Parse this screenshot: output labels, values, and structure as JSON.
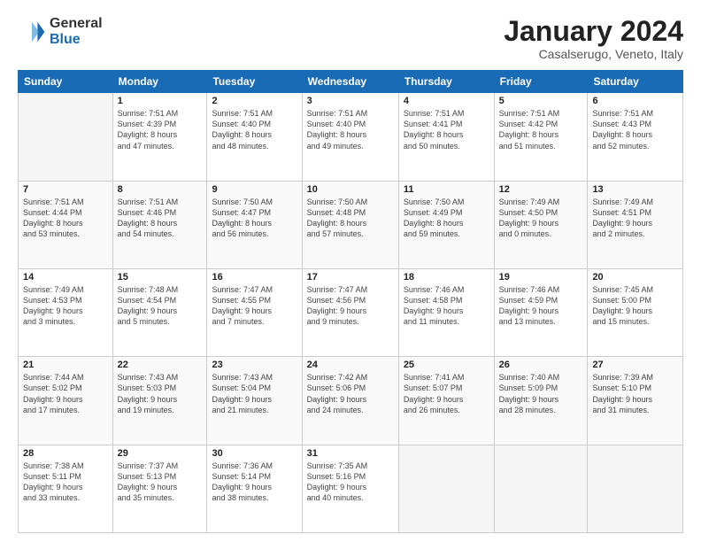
{
  "logo": {
    "general": "General",
    "blue": "Blue"
  },
  "title": "January 2024",
  "subtitle": "Casalserugo, Veneto, Italy",
  "days_header": [
    "Sunday",
    "Monday",
    "Tuesday",
    "Wednesday",
    "Thursday",
    "Friday",
    "Saturday"
  ],
  "weeks": [
    [
      {
        "num": "",
        "info": ""
      },
      {
        "num": "1",
        "info": "Sunrise: 7:51 AM\nSunset: 4:39 PM\nDaylight: 8 hours\nand 47 minutes."
      },
      {
        "num": "2",
        "info": "Sunrise: 7:51 AM\nSunset: 4:40 PM\nDaylight: 8 hours\nand 48 minutes."
      },
      {
        "num": "3",
        "info": "Sunrise: 7:51 AM\nSunset: 4:40 PM\nDaylight: 8 hours\nand 49 minutes."
      },
      {
        "num": "4",
        "info": "Sunrise: 7:51 AM\nSunset: 4:41 PM\nDaylight: 8 hours\nand 50 minutes."
      },
      {
        "num": "5",
        "info": "Sunrise: 7:51 AM\nSunset: 4:42 PM\nDaylight: 8 hours\nand 51 minutes."
      },
      {
        "num": "6",
        "info": "Sunrise: 7:51 AM\nSunset: 4:43 PM\nDaylight: 8 hours\nand 52 minutes."
      }
    ],
    [
      {
        "num": "7",
        "info": "Sunrise: 7:51 AM\nSunset: 4:44 PM\nDaylight: 8 hours\nand 53 minutes."
      },
      {
        "num": "8",
        "info": "Sunrise: 7:51 AM\nSunset: 4:46 PM\nDaylight: 8 hours\nand 54 minutes."
      },
      {
        "num": "9",
        "info": "Sunrise: 7:50 AM\nSunset: 4:47 PM\nDaylight: 8 hours\nand 56 minutes."
      },
      {
        "num": "10",
        "info": "Sunrise: 7:50 AM\nSunset: 4:48 PM\nDaylight: 8 hours\nand 57 minutes."
      },
      {
        "num": "11",
        "info": "Sunrise: 7:50 AM\nSunset: 4:49 PM\nDaylight: 8 hours\nand 59 minutes."
      },
      {
        "num": "12",
        "info": "Sunrise: 7:49 AM\nSunset: 4:50 PM\nDaylight: 9 hours\nand 0 minutes."
      },
      {
        "num": "13",
        "info": "Sunrise: 7:49 AM\nSunset: 4:51 PM\nDaylight: 9 hours\nand 2 minutes."
      }
    ],
    [
      {
        "num": "14",
        "info": "Sunrise: 7:49 AM\nSunset: 4:53 PM\nDaylight: 9 hours\nand 3 minutes."
      },
      {
        "num": "15",
        "info": "Sunrise: 7:48 AM\nSunset: 4:54 PM\nDaylight: 9 hours\nand 5 minutes."
      },
      {
        "num": "16",
        "info": "Sunrise: 7:47 AM\nSunset: 4:55 PM\nDaylight: 9 hours\nand 7 minutes."
      },
      {
        "num": "17",
        "info": "Sunrise: 7:47 AM\nSunset: 4:56 PM\nDaylight: 9 hours\nand 9 minutes."
      },
      {
        "num": "18",
        "info": "Sunrise: 7:46 AM\nSunset: 4:58 PM\nDaylight: 9 hours\nand 11 minutes."
      },
      {
        "num": "19",
        "info": "Sunrise: 7:46 AM\nSunset: 4:59 PM\nDaylight: 9 hours\nand 13 minutes."
      },
      {
        "num": "20",
        "info": "Sunrise: 7:45 AM\nSunset: 5:00 PM\nDaylight: 9 hours\nand 15 minutes."
      }
    ],
    [
      {
        "num": "21",
        "info": "Sunrise: 7:44 AM\nSunset: 5:02 PM\nDaylight: 9 hours\nand 17 minutes."
      },
      {
        "num": "22",
        "info": "Sunrise: 7:43 AM\nSunset: 5:03 PM\nDaylight: 9 hours\nand 19 minutes."
      },
      {
        "num": "23",
        "info": "Sunrise: 7:43 AM\nSunset: 5:04 PM\nDaylight: 9 hours\nand 21 minutes."
      },
      {
        "num": "24",
        "info": "Sunrise: 7:42 AM\nSunset: 5:06 PM\nDaylight: 9 hours\nand 24 minutes."
      },
      {
        "num": "25",
        "info": "Sunrise: 7:41 AM\nSunset: 5:07 PM\nDaylight: 9 hours\nand 26 minutes."
      },
      {
        "num": "26",
        "info": "Sunrise: 7:40 AM\nSunset: 5:09 PM\nDaylight: 9 hours\nand 28 minutes."
      },
      {
        "num": "27",
        "info": "Sunrise: 7:39 AM\nSunset: 5:10 PM\nDaylight: 9 hours\nand 31 minutes."
      }
    ],
    [
      {
        "num": "28",
        "info": "Sunrise: 7:38 AM\nSunset: 5:11 PM\nDaylight: 9 hours\nand 33 minutes."
      },
      {
        "num": "29",
        "info": "Sunrise: 7:37 AM\nSunset: 5:13 PM\nDaylight: 9 hours\nand 35 minutes."
      },
      {
        "num": "30",
        "info": "Sunrise: 7:36 AM\nSunset: 5:14 PM\nDaylight: 9 hours\nand 38 minutes."
      },
      {
        "num": "31",
        "info": "Sunrise: 7:35 AM\nSunset: 5:16 PM\nDaylight: 9 hours\nand 40 minutes."
      },
      {
        "num": "",
        "info": ""
      },
      {
        "num": "",
        "info": ""
      },
      {
        "num": "",
        "info": ""
      }
    ]
  ]
}
